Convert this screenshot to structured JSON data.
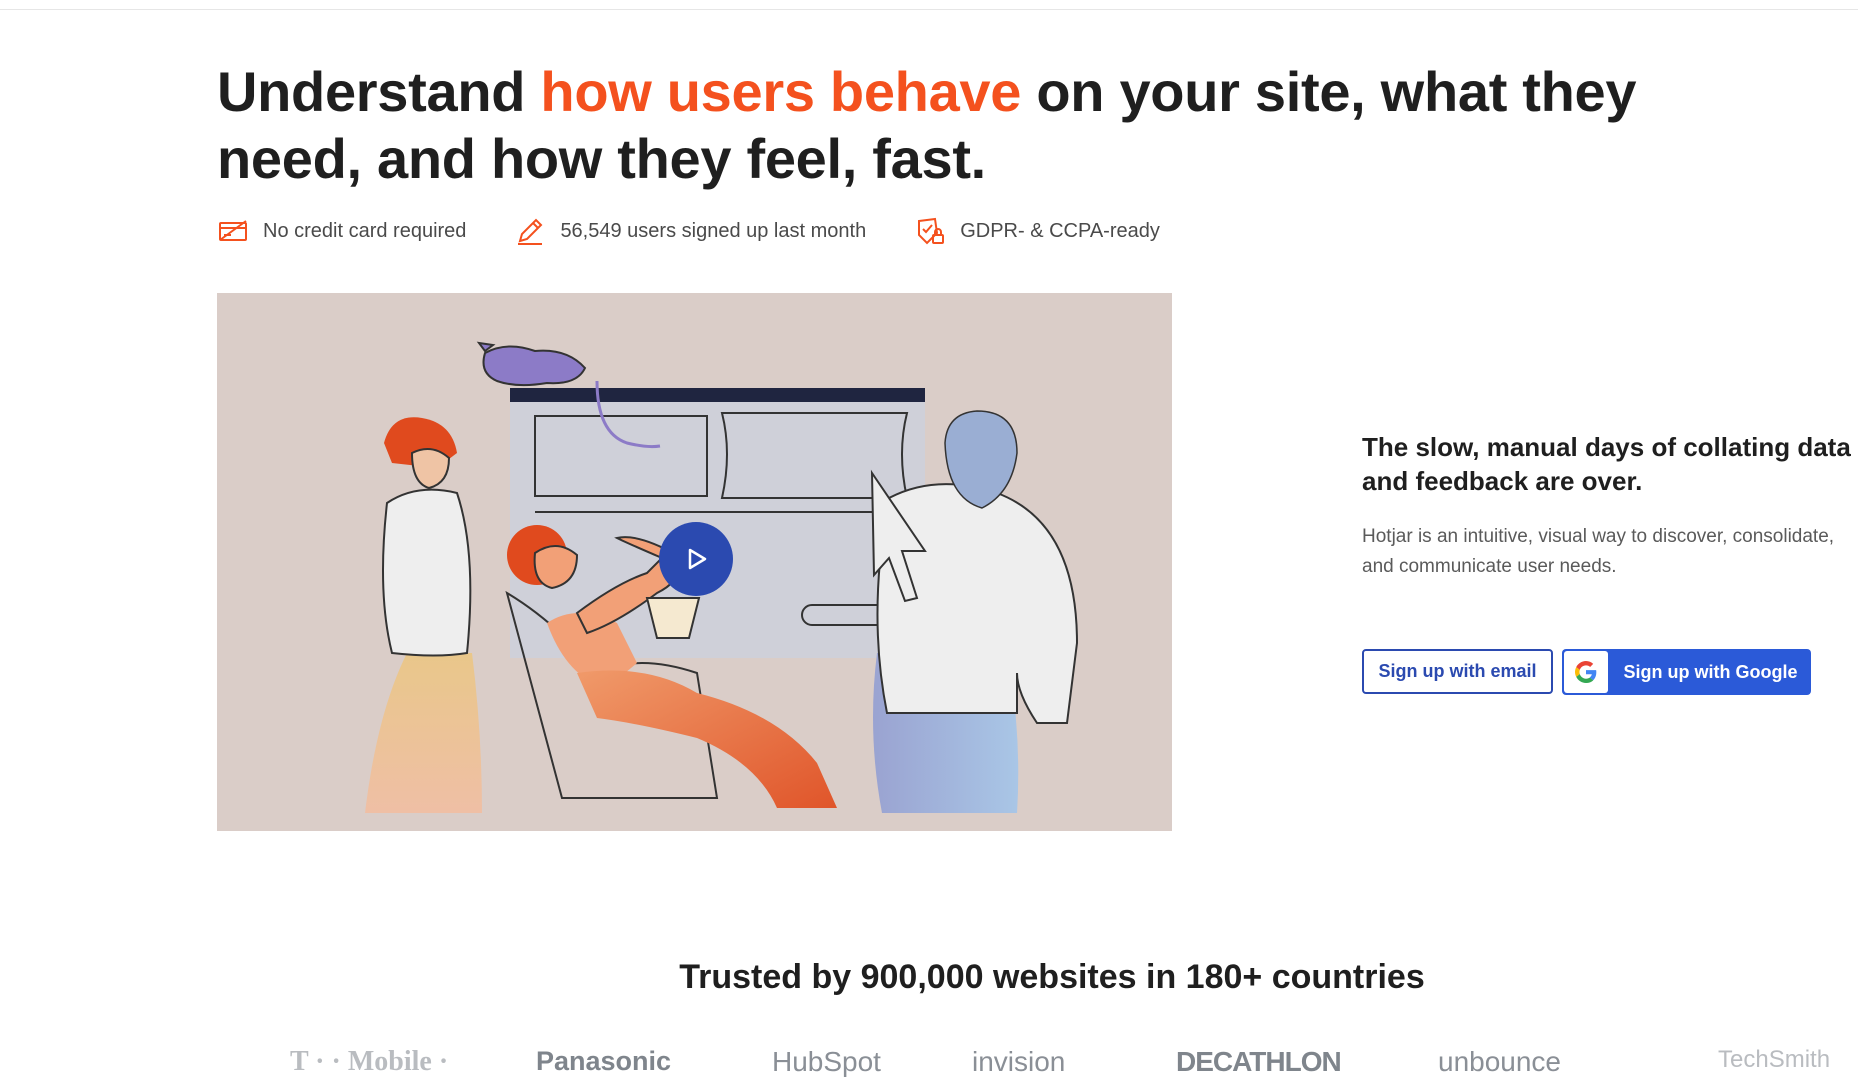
{
  "hero": {
    "title_part1": "Understand ",
    "title_accent": "how users behave",
    "title_part2": " on your site, what they need, and how they feel, fast.",
    "accent_color": "#f4511e"
  },
  "badges": [
    {
      "icon": "credit-card-icon",
      "label": "No credit card required"
    },
    {
      "icon": "pencil-icon",
      "label": "56,549 users signed up last month"
    },
    {
      "icon": "shield-lock-icon",
      "label": "GDPR- & CCPA-ready"
    }
  ],
  "video": {
    "play_icon": "play-icon",
    "background_color": "#dacdc8"
  },
  "side": {
    "title_line1": "The slow, manual days of collating data",
    "title_line2": "and feedback are over.",
    "text_line1": "Hotjar is an intuitive, visual way to discover, consolidate,",
    "text_line2": "and communicate user needs."
  },
  "cta": {
    "email_label": "Sign up with email",
    "google_label": "Sign up with Google",
    "google_icon": "google-icon",
    "primary_color": "#2b4ab0"
  },
  "trusted": {
    "heading": "Trusted by 900,000 websites in 180+ countries",
    "logos": [
      "T · · Mobile ·",
      "Panasonic",
      "HubSpot",
      "invision",
      "DECATHLON",
      "unbounce",
      "TechSmith"
    ]
  }
}
